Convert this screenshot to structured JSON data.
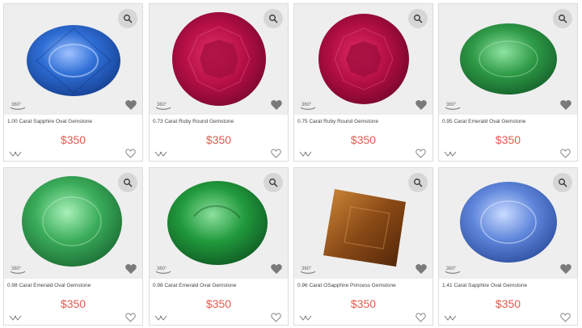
{
  "products": [
    {
      "title": "1.00 Carat Sapphire Oval Gemstone",
      "price": "$350",
      "stone": "sapphire-oval",
      "color": "#2a62c8"
    },
    {
      "title": "0.73 Carat Ruby Round Gemstone",
      "price": "$350",
      "stone": "ruby-round",
      "color": "#c1124a"
    },
    {
      "title": "0.75 Carat Ruby Round Gemstone",
      "price": "$350",
      "stone": "ruby-round",
      "color": "#bf1045"
    },
    {
      "title": "0.95 Carat Emerald Oval Gemstone",
      "price": "$350",
      "stone": "emerald-oval",
      "color": "#2e9a46"
    },
    {
      "title": "0.98 Carat Emerald Oval Gemstone",
      "price": "$350",
      "stone": "emerald-oval",
      "color": "#3aac5a"
    },
    {
      "title": "0.98 Carat Emerald Oval Gemstone",
      "price": "$350",
      "stone": "emerald-oval",
      "color": "#219a3c"
    },
    {
      "title": "0.96 Carat OSapphire Princess Gemstone",
      "price": "$350",
      "stone": "sapphire-princess",
      "color": "#8a4a16"
    },
    {
      "title": "1.41 Carat Sapphire Oval Gemstone",
      "price": "$350",
      "stone": "sapphire-oval",
      "color": "#5f86db"
    }
  ],
  "icons": {
    "zoom": "search-icon",
    "rotate": "360-view-icon",
    "badge": "heart-badge-icon",
    "compare": "compare-icon",
    "favorite": "heart-outline-icon"
  },
  "accent": "#e25a4f"
}
